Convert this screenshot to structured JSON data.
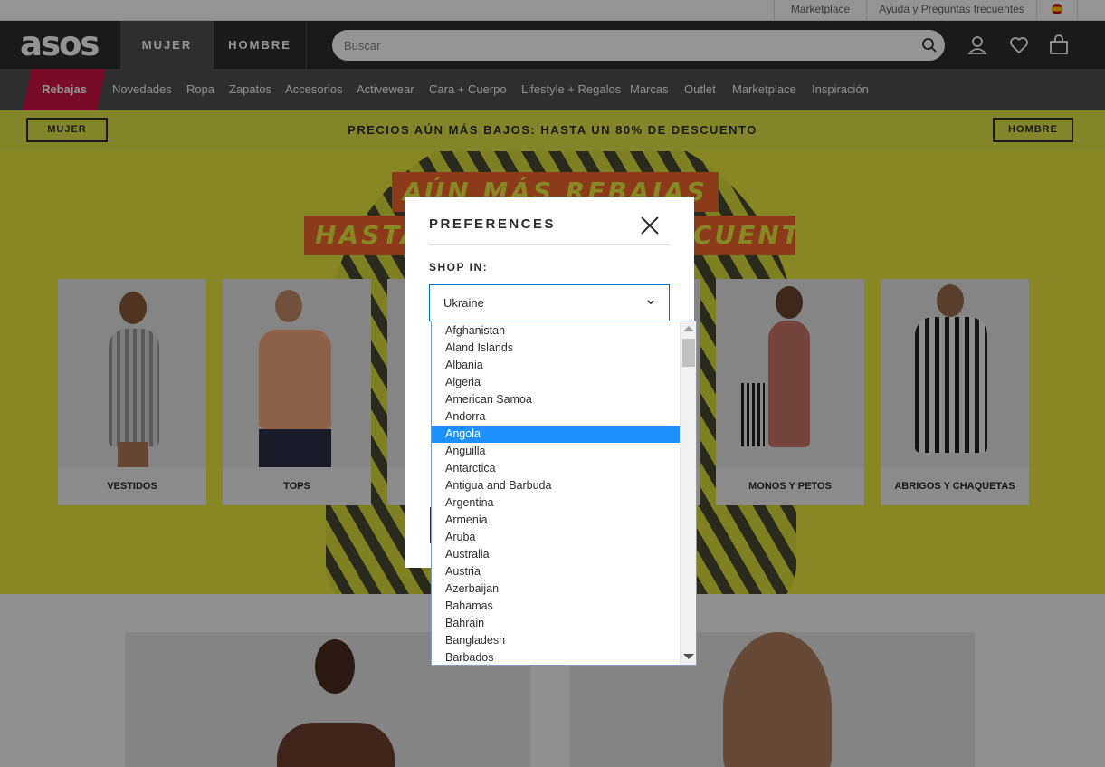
{
  "utility_bar": {
    "marketplace": "Marketplace",
    "help": "Ayuda y Preguntas frecuentes",
    "flag_icon": "spain-flag-icon"
  },
  "header": {
    "logo": "asos",
    "tabs": [
      "MUJER",
      "HOMBRE"
    ],
    "search": {
      "placeholder": "Buscar",
      "icon": "search-icon"
    },
    "icons": [
      "account-icon",
      "heart-icon",
      "bag-icon"
    ]
  },
  "category_nav": {
    "sale": "Rebajas",
    "items": [
      "Novedades",
      "Ropa",
      "Zapatos",
      "Accesorios",
      "Activewear",
      "Cara + Cuerpo",
      "Lifestyle + Regalos",
      "Marcas",
      "Outlet",
      "Marketplace",
      "Inspiración"
    ]
  },
  "promo": {
    "left_button": "MUJER",
    "text": "PRECIOS AÚN MÁS BAJOS: HASTA UN 80% DE DESCUENTO",
    "right_button": "HOMBRE"
  },
  "hero": {
    "line1": "AÚN MÁS REBAJAS",
    "line2": "HASTA UN 80% DE DESCUENTO",
    "categories": [
      "VESTIDOS",
      "TOPS",
      "",
      "",
      "MONOS Y PETOS",
      "ABRIGOS Y CHAQUETAS"
    ]
  },
  "modal": {
    "title": "PREFERENCES",
    "close_icon": "close-icon",
    "shop_in_label": "SHOP IN:",
    "selected_country": "Ukraine",
    "chevron_icon": "chevron-down-icon",
    "highlighted_option": "Angola",
    "options": [
      "Afghanistan",
      "Aland Islands",
      "Albania",
      "Algeria",
      "American Samoa",
      "Andorra",
      "Angola",
      "Anguilla",
      "Antarctica",
      "Antigua and Barbuda",
      "Argentina",
      "Armenia",
      "Aruba",
      "Australia",
      "Austria",
      "Azerbaijan",
      "Bahamas",
      "Bahrain",
      "Bangladesh",
      "Barbados"
    ]
  },
  "colors": {
    "header_bg": "#2d2d2d",
    "nav_bg": "#525050",
    "sale_accent": "#d01345",
    "promo_yellow": "#e2e64a",
    "hero_orange": "#f0672d",
    "select_highlight": "#1e90ff"
  }
}
